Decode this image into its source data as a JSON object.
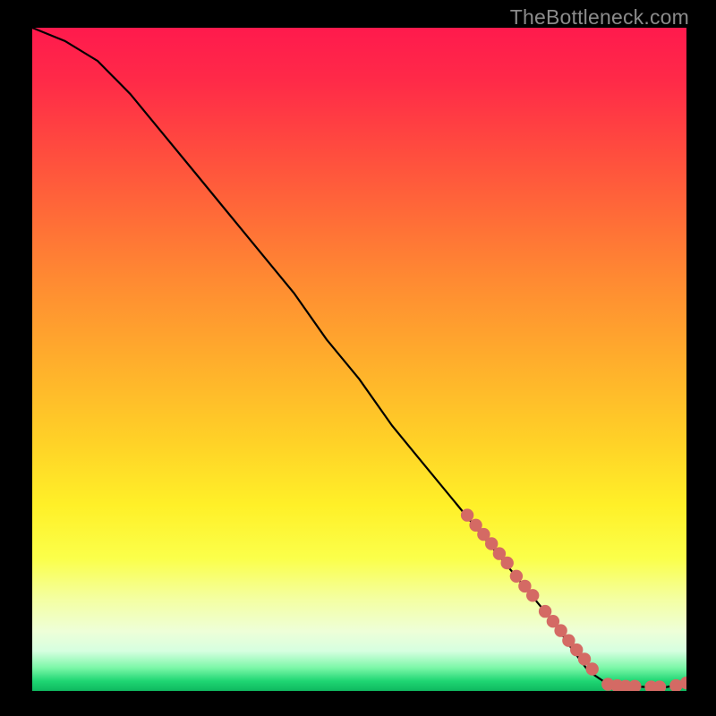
{
  "watermark": "TheBottleneck.com",
  "chart_data": {
    "type": "line",
    "title": "",
    "xlabel": "",
    "ylabel": "",
    "xlim": [
      0,
      100
    ],
    "ylim": [
      0,
      100
    ],
    "series": [
      {
        "name": "curve",
        "x": [
          0,
          5,
          10,
          15,
          20,
          25,
          30,
          35,
          40,
          45,
          50,
          55,
          60,
          65,
          70,
          75,
          80,
          82,
          85,
          88,
          91,
          94,
          97,
          100
        ],
        "y": [
          100,
          98,
          95,
          90,
          84,
          78,
          72,
          66,
          60,
          53,
          47,
          40,
          34,
          28,
          22,
          16,
          10,
          7,
          3,
          1,
          0.7,
          0.6,
          0.6,
          1.2
        ]
      }
    ],
    "markers": [
      {
        "name": "segment-markers",
        "color": "#d46a64",
        "points": [
          {
            "x": 66.5,
            "y": 26.5
          },
          {
            "x": 67.8,
            "y": 25.0
          },
          {
            "x": 69.0,
            "y": 23.6
          },
          {
            "x": 70.2,
            "y": 22.2
          },
          {
            "x": 71.4,
            "y": 20.7
          },
          {
            "x": 72.6,
            "y": 19.3
          },
          {
            "x": 74.0,
            "y": 17.3
          },
          {
            "x": 75.3,
            "y": 15.8
          },
          {
            "x": 76.5,
            "y": 14.4
          },
          {
            "x": 78.4,
            "y": 12.0
          },
          {
            "x": 79.6,
            "y": 10.5
          },
          {
            "x": 80.8,
            "y": 9.1
          },
          {
            "x": 82.0,
            "y": 7.6
          },
          {
            "x": 83.2,
            "y": 6.2
          },
          {
            "x": 84.4,
            "y": 4.8
          },
          {
            "x": 85.6,
            "y": 3.3
          },
          {
            "x": 88.0,
            "y": 1.0
          },
          {
            "x": 89.4,
            "y": 0.8
          },
          {
            "x": 90.7,
            "y": 0.7
          },
          {
            "x": 92.1,
            "y": 0.7
          },
          {
            "x": 94.6,
            "y": 0.6
          },
          {
            "x": 95.9,
            "y": 0.6
          },
          {
            "x": 98.4,
            "y": 0.8
          },
          {
            "x": 100.0,
            "y": 1.2
          }
        ]
      }
    ]
  }
}
